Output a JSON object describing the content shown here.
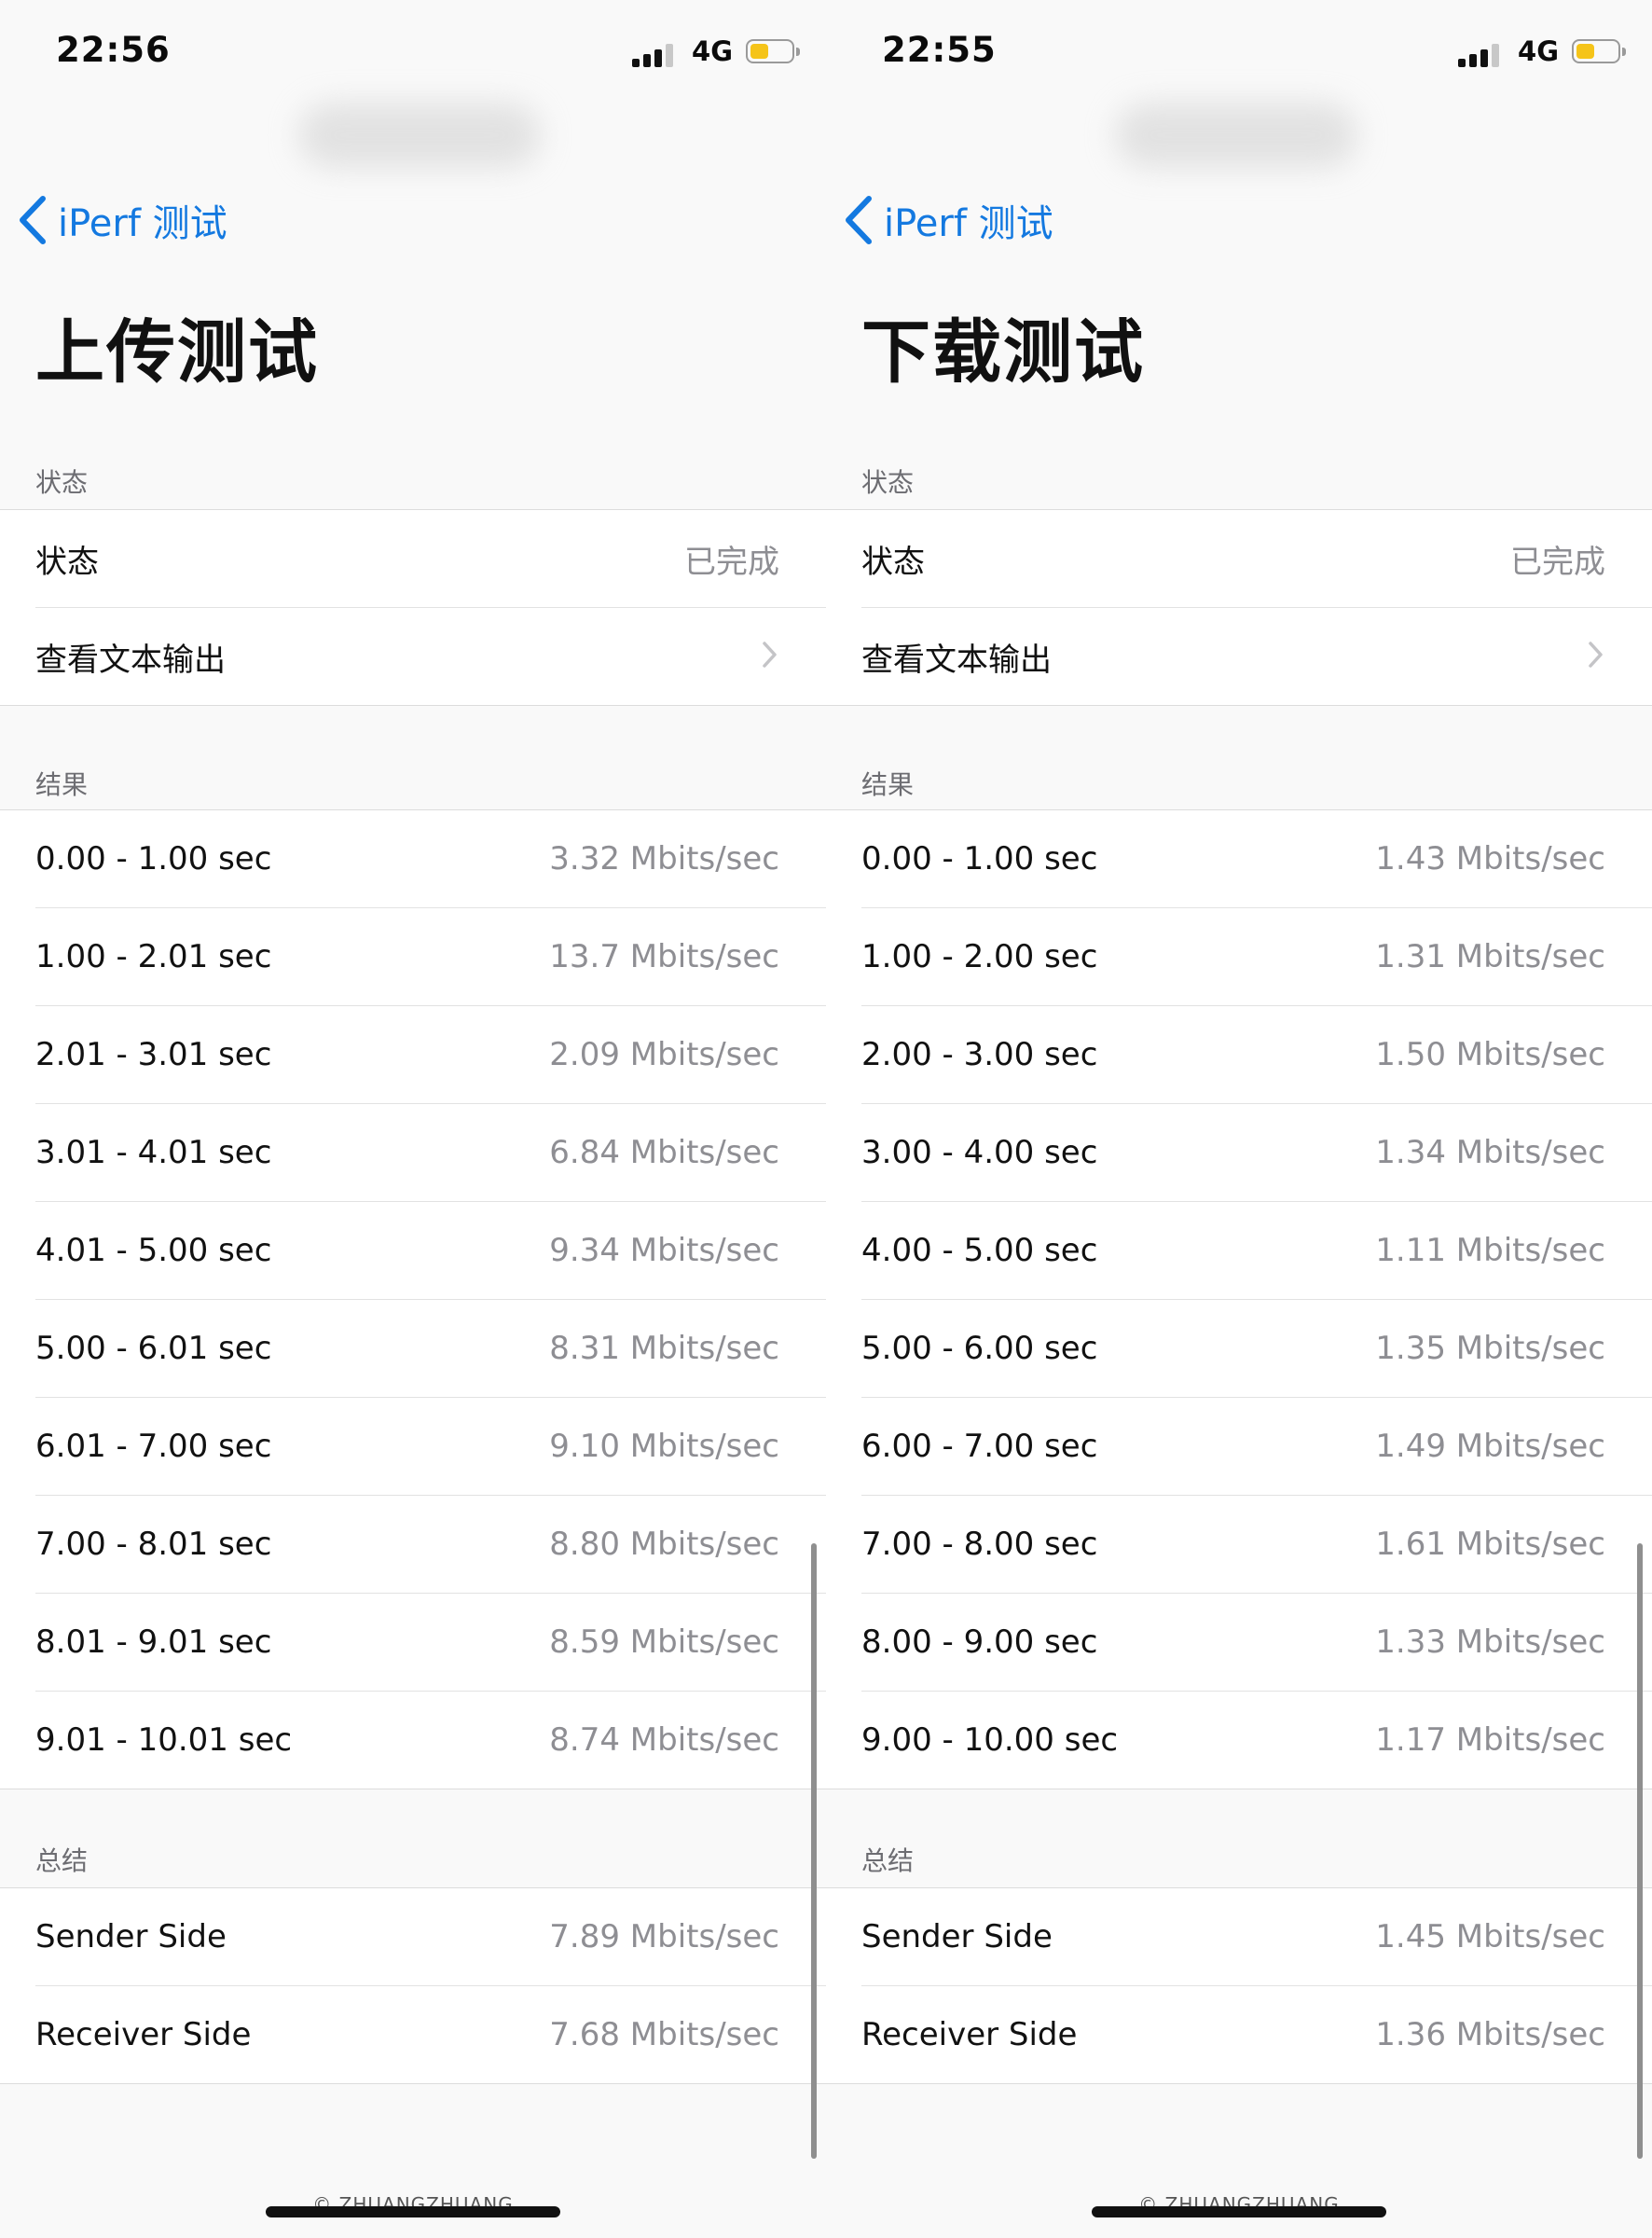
{
  "screens": [
    {
      "status": {
        "time": "22:56",
        "network": "4G"
      },
      "nav": {
        "back_label": "iPerf 测试"
      },
      "title": "上传测试",
      "status_section": {
        "header": "状态",
        "status_label": "状态",
        "status_value": "已完成",
        "text_output_label": "查看文本输出"
      },
      "results_section": {
        "header": "结果",
        "rows": [
          {
            "interval": "0.00 - 1.00 sec",
            "rate": "3.32 Mbits/sec"
          },
          {
            "interval": "1.00 - 2.01 sec",
            "rate": "13.7 Mbits/sec"
          },
          {
            "interval": "2.01 - 3.01 sec",
            "rate": "2.09 Mbits/sec"
          },
          {
            "interval": "3.01 - 4.01 sec",
            "rate": "6.84 Mbits/sec"
          },
          {
            "interval": "4.01 - 5.00 sec",
            "rate": "9.34 Mbits/sec"
          },
          {
            "interval": "5.00 - 6.01 sec",
            "rate": "8.31 Mbits/sec"
          },
          {
            "interval": "6.01 - 7.00 sec",
            "rate": "9.10 Mbits/sec"
          },
          {
            "interval": "7.00 - 8.01 sec",
            "rate": "8.80 Mbits/sec"
          },
          {
            "interval": "8.01 - 9.01 sec",
            "rate": "8.59 Mbits/sec"
          },
          {
            "interval": "9.01 - 10.01 sec",
            "rate": "8.74 Mbits/sec"
          }
        ]
      },
      "summary_section": {
        "header": "总结",
        "sender_label": "Sender Side",
        "sender_value": "7.89 Mbits/sec",
        "receiver_label": "Receiver Side",
        "receiver_value": "7.68 Mbits/sec"
      },
      "watermark": "© ZHUANGZHUANG"
    },
    {
      "status": {
        "time": "22:55",
        "network": "4G"
      },
      "nav": {
        "back_label": "iPerf 测试"
      },
      "title": "下载测试",
      "status_section": {
        "header": "状态",
        "status_label": "状态",
        "status_value": "已完成",
        "text_output_label": "查看文本输出"
      },
      "results_section": {
        "header": "结果",
        "rows": [
          {
            "interval": "0.00 - 1.00 sec",
            "rate": "1.43 Mbits/sec"
          },
          {
            "interval": "1.00 - 2.00 sec",
            "rate": "1.31 Mbits/sec"
          },
          {
            "interval": "2.00 - 3.00 sec",
            "rate": "1.50 Mbits/sec"
          },
          {
            "interval": "3.00 - 4.00 sec",
            "rate": "1.34 Mbits/sec"
          },
          {
            "interval": "4.00 - 5.00 sec",
            "rate": "1.11 Mbits/sec"
          },
          {
            "interval": "5.00 - 6.00 sec",
            "rate": "1.35 Mbits/sec"
          },
          {
            "interval": "6.00 - 7.00 sec",
            "rate": "1.49 Mbits/sec"
          },
          {
            "interval": "7.00 - 8.00 sec",
            "rate": "1.61 Mbits/sec"
          },
          {
            "interval": "8.00 - 9.00 sec",
            "rate": "1.33 Mbits/sec"
          },
          {
            "interval": "9.00 - 10.00 sec",
            "rate": "1.17 Mbits/sec"
          }
        ]
      },
      "summary_section": {
        "header": "总结",
        "sender_label": "Sender Side",
        "sender_value": "1.45 Mbits/sec",
        "receiver_label": "Receiver Side",
        "receiver_value": "1.36 Mbits/sec"
      },
      "watermark": "© ZHUANGZHUANG"
    }
  ],
  "colors": {
    "accent": "#1479e0",
    "secondary_text": "#8e8e93",
    "battery": "#f5c419"
  },
  "icons": [
    "back-chevron-icon",
    "disclosure-chevron-icon",
    "signal-icon",
    "battery-icon"
  ]
}
